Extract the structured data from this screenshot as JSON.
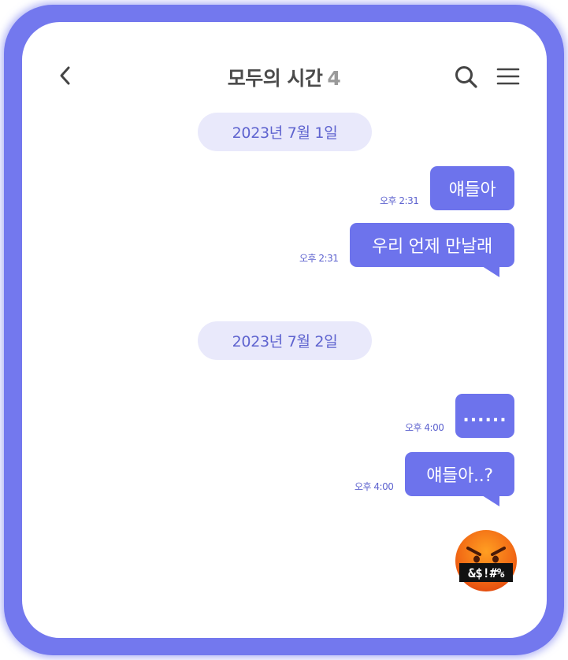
{
  "header": {
    "back_icon": "chevron-left-icon",
    "title": "모두의 시간",
    "member_count": "4",
    "search_icon": "search-icon",
    "menu_icon": "hamburger-menu-icon"
  },
  "colors": {
    "frame": "#7378ee",
    "bubble": "#6d73ec",
    "date_pill_bg": "#e9e9fb",
    "accent_text": "#5e63cf"
  },
  "dates": [
    "2023년 7월 1일",
    "2023년 7월 2일"
  ],
  "messages": [
    {
      "text": "얘들아",
      "time": "오후 2:31"
    },
    {
      "text": "우리 언제 만날래",
      "time": "오후 2:31"
    },
    {
      "text": "......",
      "time": "오후 4:00"
    },
    {
      "text": "얘들아..?",
      "time": "오후 4:00"
    }
  ],
  "reaction": {
    "icon": "angry-face-emoji-icon",
    "censored_text": "&$!#%"
  }
}
